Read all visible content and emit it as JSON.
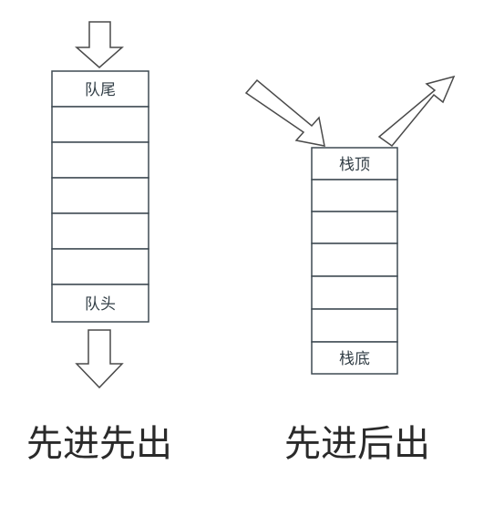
{
  "queue": {
    "tail_label": "队尾",
    "head_label": "队头",
    "caption": "先进先出"
  },
  "stack": {
    "top_label": "栈顶",
    "bottom_label": "栈底",
    "caption": "先进后出"
  }
}
